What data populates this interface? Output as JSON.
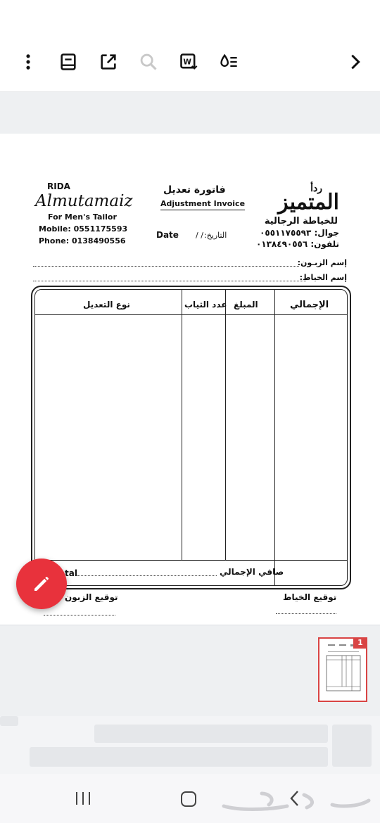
{
  "toolbar": {
    "icons": [
      "more-vert-icon",
      "book-icon",
      "open-external-icon",
      "search-icon",
      "word-convert-icon",
      "reading-mode-icon",
      "chevron-right-icon"
    ]
  },
  "invoice": {
    "brand_small": "ردأ",
    "brand_name_ar": "المتميز",
    "brand_sub_ar": "للخياطة الرجالية",
    "mobile_ar": "جوال: ٠٥٥١١٧٥٥٩٣",
    "phone_ar": "تلفون: ٠١٣٨٤٩٠٥٥٦",
    "title_ar": "فاتورة تعديل",
    "title_en": "Adjustment Invoice",
    "date_en": "Date",
    "date_sep": "/     /",
    "date_ar": "التاريخ:",
    "rida": "RIDA",
    "brand_name_en": "Almutamaiz",
    "tailor_en": "For Men's Tailor",
    "mobile_en": "Mobile: 0551175593",
    "phone_en": "Phone: 0138490556",
    "customer_name_label": "إسم الزبـون:",
    "tailor_name_label": "إسم الخياط:",
    "col_total": "الإجمالي",
    "col_amount": "المبلغ",
    "col_count": "عدد الثياب",
    "col_type": "نوع التعديل",
    "net_total_ar": "صافي الإجمالي",
    "net_total_en": "tal",
    "tailor_signature": "توقيع الخياط",
    "customer_signature": "توقيع الزبون"
  },
  "thumbnail": {
    "page_number": "1"
  },
  "colors": {
    "accent": "#e8323c",
    "background_gray": "#eef0f2"
  },
  "fab": {
    "icon": "edit-pencil-icon"
  },
  "navbar": {
    "icons": [
      "recent-apps-icon",
      "home-icon",
      "back-icon"
    ]
  }
}
